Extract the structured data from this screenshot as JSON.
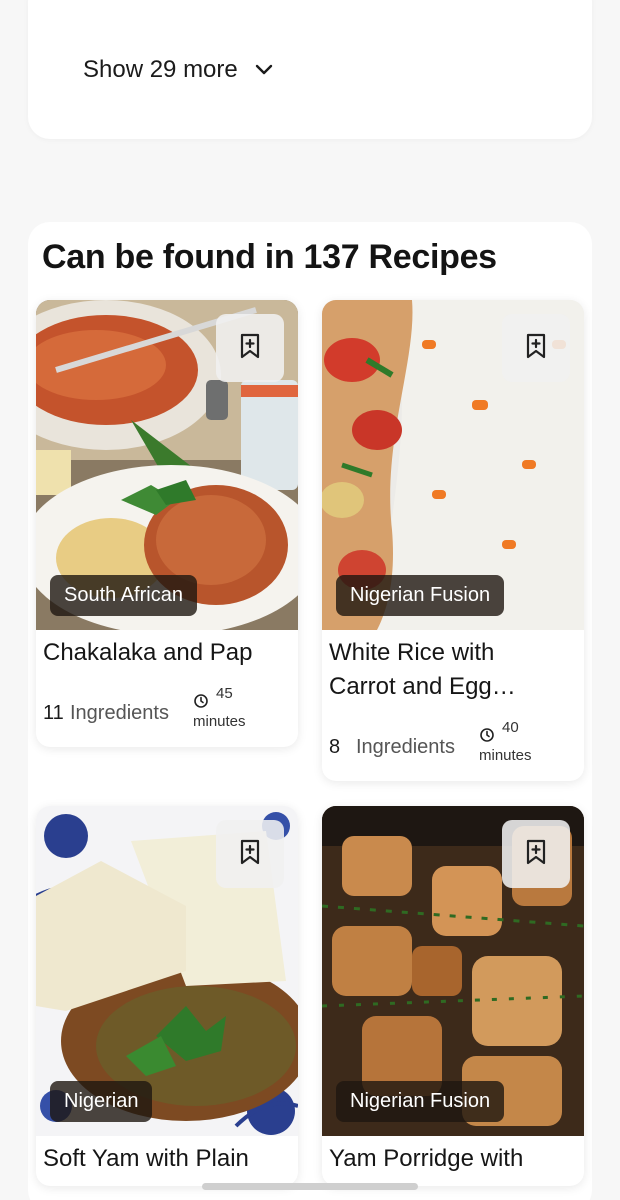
{
  "show_more": {
    "label": "Show 29 more",
    "icon": "chevron-down-icon"
  },
  "section": {
    "title": "Can be found in 137 Recipes"
  },
  "recipes": [
    {
      "title": "Chakalaka and Pap",
      "cuisine": "South African",
      "ingredient_count": "11",
      "ingredients_label": "Ingredients",
      "time_value": "45",
      "time_unit": "minutes",
      "bookmark_icon": "bookmark-plus-icon"
    },
    {
      "title": "White Rice with Carrot and Egg…",
      "cuisine": "Nigerian Fusion",
      "ingredient_count": "8",
      "ingredients_label": "Ingredients",
      "time_value": "40",
      "time_unit": "minutes",
      "bookmark_icon": "bookmark-plus-icon"
    },
    {
      "title": "Soft Yam with Plain",
      "cuisine": "Nigerian",
      "bookmark_icon": "bookmark-plus-icon"
    },
    {
      "title": "Yam Porridge with",
      "cuisine": "Nigerian Fusion",
      "bookmark_icon": "bookmark-plus-icon"
    }
  ],
  "colors": {
    "page_bg": "#f7f7f7",
    "card_bg": "#ffffff",
    "tag_bg": "#2a1f17",
    "text": "#1b1b1b",
    "muted": "#555555"
  }
}
